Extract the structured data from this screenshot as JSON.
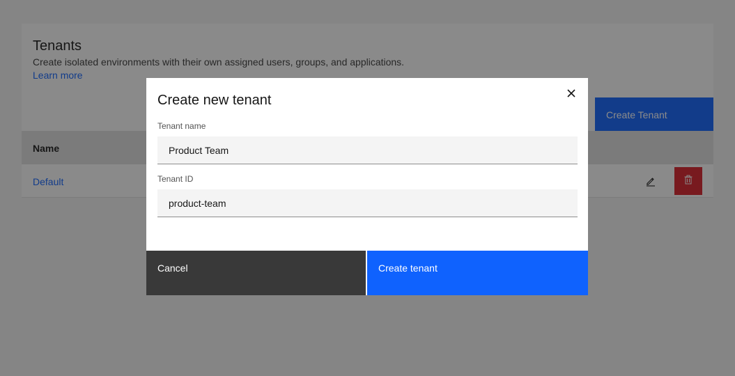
{
  "page": {
    "title": "Tenants",
    "description": "Create isolated environments with their own assigned users, groups, and applications.",
    "learn_more": "Learn more",
    "create_button": "Create Tenant"
  },
  "table": {
    "headers": [
      "Name"
    ],
    "rows": [
      {
        "name": "Default"
      }
    ]
  },
  "modal": {
    "title": "Create new tenant",
    "fields": {
      "tenant_name": {
        "label": "Tenant name",
        "value": "Product Team"
      },
      "tenant_id": {
        "label": "Tenant ID",
        "value": "product-team"
      }
    },
    "cancel_label": "Cancel",
    "submit_label": "Create tenant"
  },
  "icons": {
    "close": "close-icon",
    "edit": "edit-icon",
    "delete": "trash-icon"
  },
  "colors": {
    "primary": "#0f62fe",
    "danger": "#da1e28",
    "secondary": "#393939",
    "overlay": "rgba(22,22,22,0.5)"
  }
}
